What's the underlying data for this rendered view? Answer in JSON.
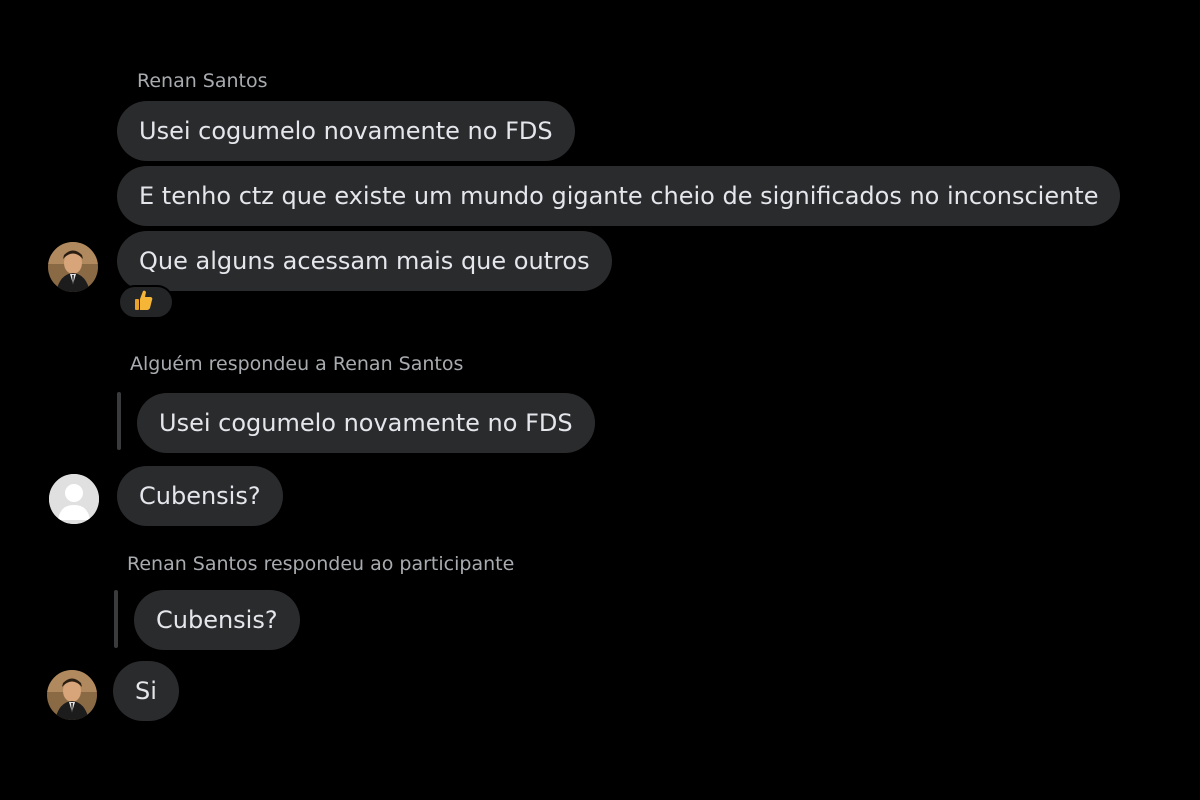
{
  "conversation": {
    "group1": {
      "sender": "Renan Santos",
      "messages": [
        "Usei cogumelo novamente no FDS",
        "E tenho ctz que existe um mundo gigante cheio de significados no inconsciente",
        "Que alguns acessam mais que outros"
      ],
      "reaction_icon": "thumbs-up-emoji"
    },
    "reply1": {
      "label": "Alguém respondeu a Renan Santos",
      "quoted": "Usei cogumelo novamente no FDS",
      "message": "Cubensis?"
    },
    "reply2": {
      "label": "Renan Santos respondeu ao participante",
      "quoted": "Cubensis?",
      "message": "Si"
    }
  },
  "colors": {
    "background": "#000000",
    "bubble": "#2a2b2d",
    "text": "#e4e6eb",
    "meta_text": "#a8abaf"
  }
}
